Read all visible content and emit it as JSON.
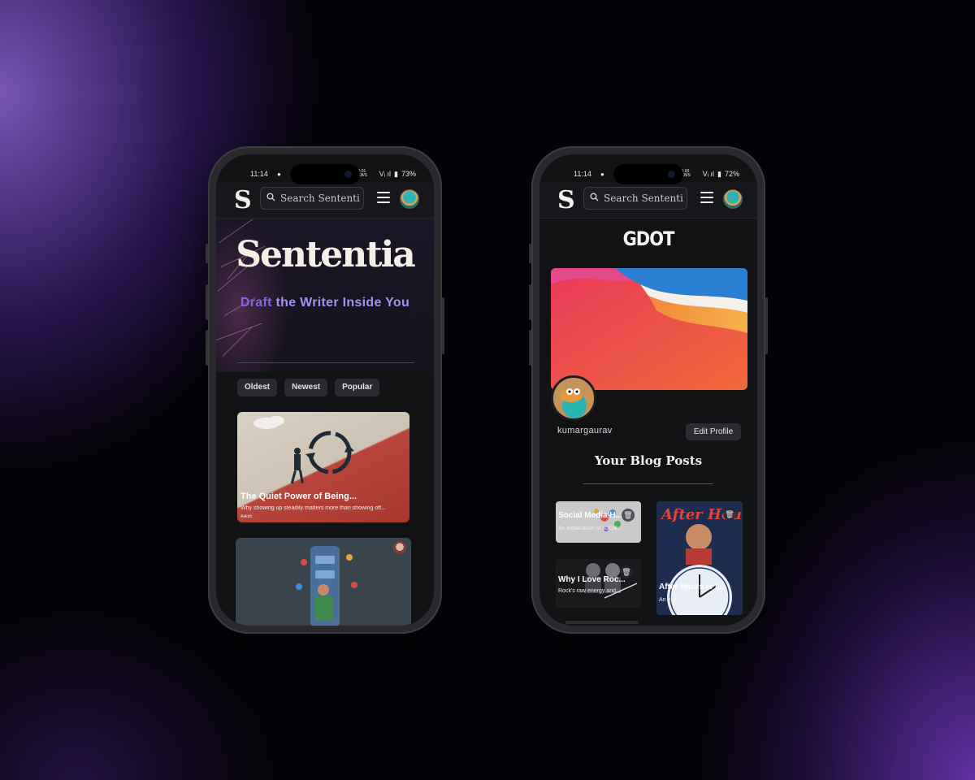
{
  "colors": {
    "accent_purple": "#a691ee",
    "accent_purple_dark": "#8267e0",
    "screen_bg": "#111214",
    "chip_bg": "#2a2b31"
  },
  "left_phone": {
    "status": {
      "time": "11:14",
      "signal": "Vᵢ ıl",
      "battery": "73%",
      "data_rate": "0.01 KB/S"
    },
    "topbar": {
      "logo": "S",
      "search_placeholder": "Search Sententi",
      "search_icon": "search-icon",
      "menu_icon": "hamburger-icon"
    },
    "hero": {
      "brand": "Sententia",
      "tagline_first": "Draft",
      "tagline_rest": " the Writer Inside You"
    },
    "filters": [
      "Oldest",
      "Newest",
      "Popular"
    ],
    "posts": [
      {
        "title": "The Quiet Power of Being...",
        "description": "Why showing up steadily matters more than showing off...",
        "author": "Aakriti"
      }
    ]
  },
  "right_phone": {
    "status": {
      "time": "11:14",
      "signal": "Vᵢ ıl",
      "battery": "72%",
      "data_rate": "0.00 KB/S"
    },
    "topbar": {
      "logo": "S",
      "search_placeholder": "Search Sententi",
      "search_icon": "search-icon",
      "menu_icon": "hamburger-icon"
    },
    "profile": {
      "display_name": "GDOT",
      "username": "kumargaurav",
      "edit_button": "Edit Profile"
    },
    "blog_heading": "Your Blog Posts",
    "posts": [
      {
        "title": "Social Media H...",
        "description": "An exploration of social..."
      },
      {
        "title": "After Hours is t...",
        "description": "An exploration of Martin...",
        "poster_text": "After Hours"
      },
      {
        "title": "Why I Love Roc...",
        "description": "Rock's raw energy and..."
      }
    ]
  }
}
